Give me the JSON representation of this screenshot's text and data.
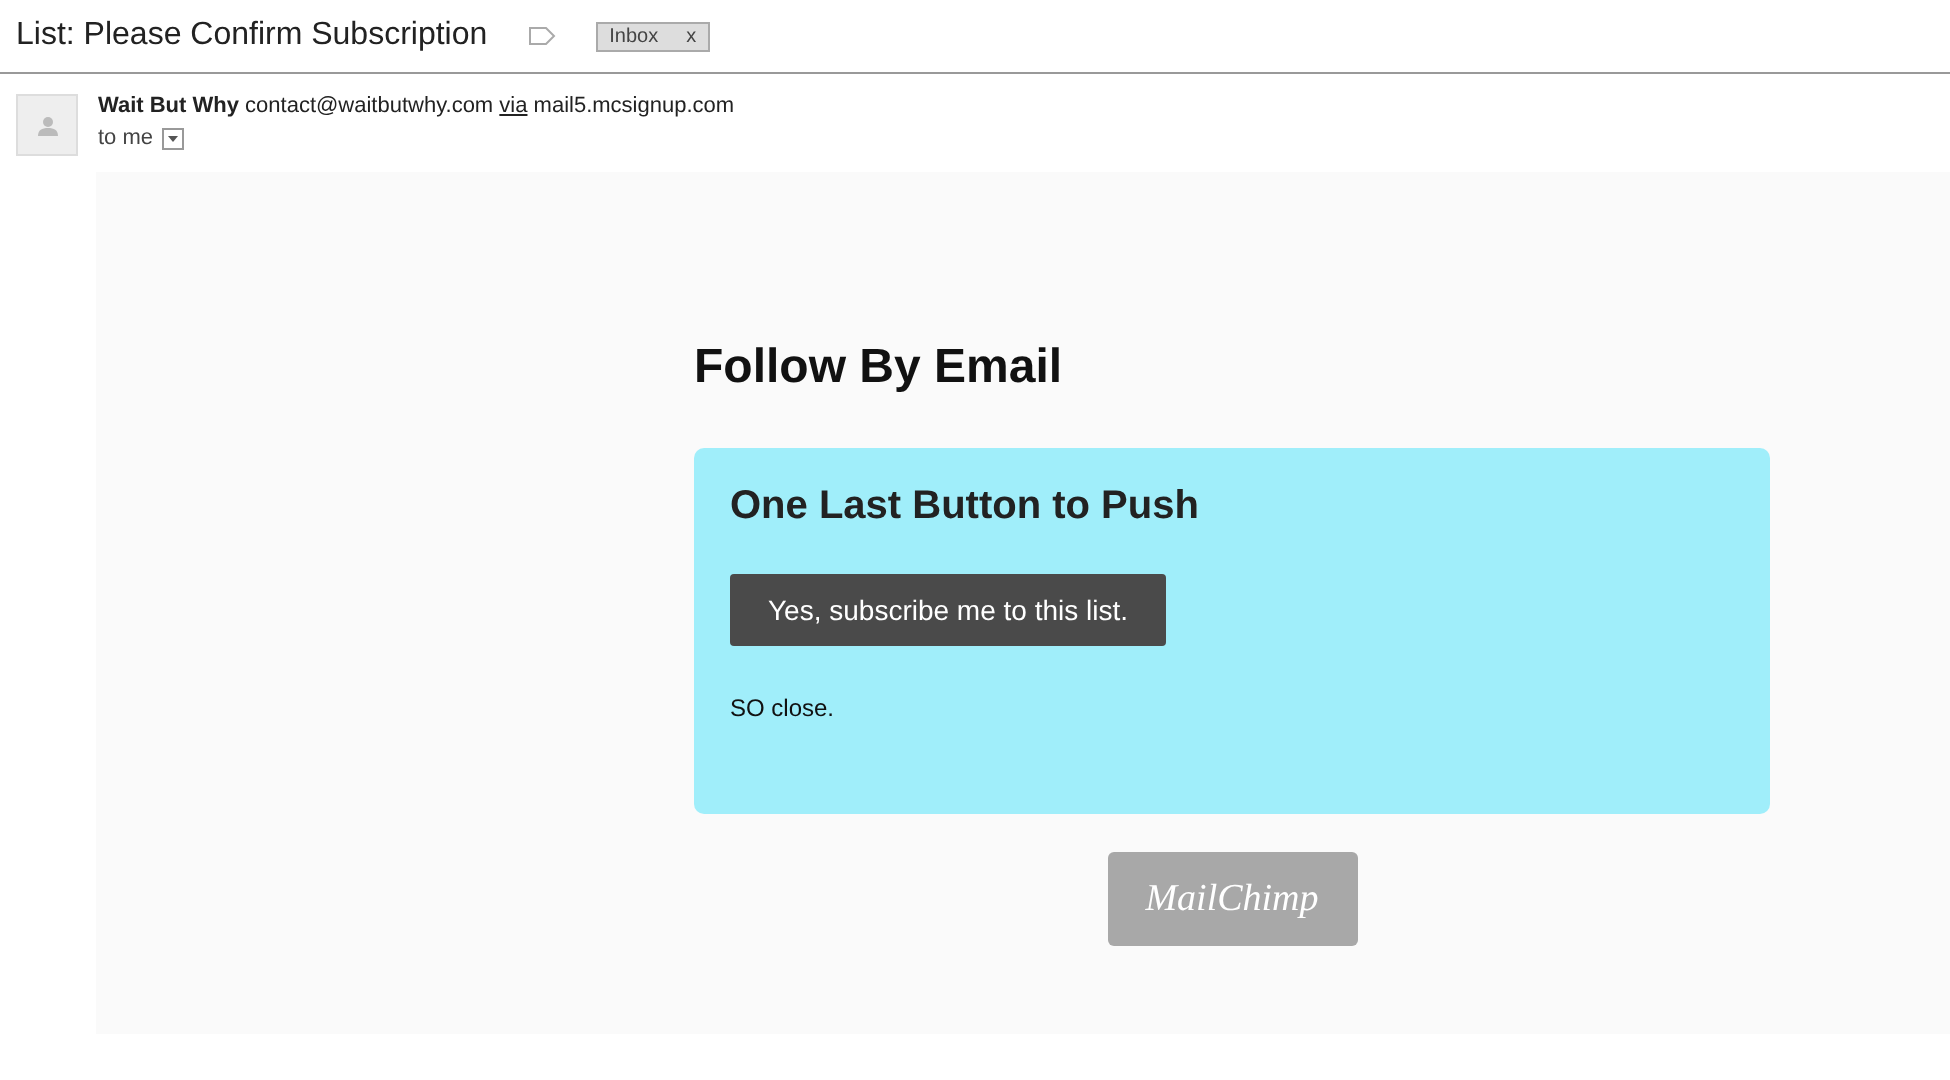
{
  "subject": "List: Please Confirm Subscription",
  "label": {
    "text": "Inbox",
    "close": "x"
  },
  "sender": {
    "name": "Wait But Why",
    "email": "contact@waitbutwhy.com",
    "via": "via",
    "domain": "mail5.mcsignup.com",
    "recipient": "to me"
  },
  "content": {
    "heading": "Follow By Email",
    "card_title": "One Last Button to Push",
    "button": "Yes, subscribe me to this list.",
    "note": "SO close.",
    "logo": "MailChimp"
  }
}
